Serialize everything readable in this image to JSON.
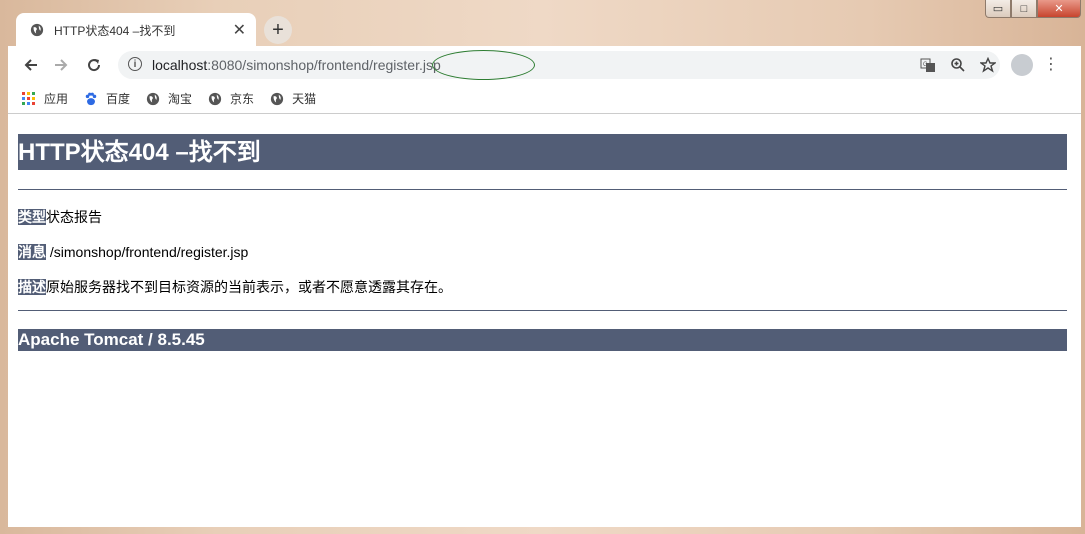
{
  "tab": {
    "title": "HTTP状态404 –找不到"
  },
  "address": {
    "host": "localhost",
    "path": ":8080/simonshop/frontend/register.jsp"
  },
  "bookmarks": [
    {
      "label": "应用",
      "icon": "apps-icon"
    },
    {
      "label": "百度",
      "icon": "baidu-paw-icon"
    },
    {
      "label": "淘宝",
      "icon": "globe-icon"
    },
    {
      "label": "京东",
      "icon": "globe-icon"
    },
    {
      "label": "天猫",
      "icon": "globe-icon"
    }
  ],
  "page": {
    "heading": "HTTP状态404 –找不到",
    "type_label": "类型",
    "type_value": "状态报告",
    "message_label": "消息",
    "message_value": " /simonshop/frontend/register.jsp",
    "desc_label": "描述",
    "desc_value": "原始服务器找不到目标资源的当前表示，或者不愿意透露其存在。",
    "footer": "Apache Tomcat / 8.5.45"
  },
  "colors": {
    "tomcat_header": "#525d76",
    "annotation_circle": "#2e7d32"
  }
}
